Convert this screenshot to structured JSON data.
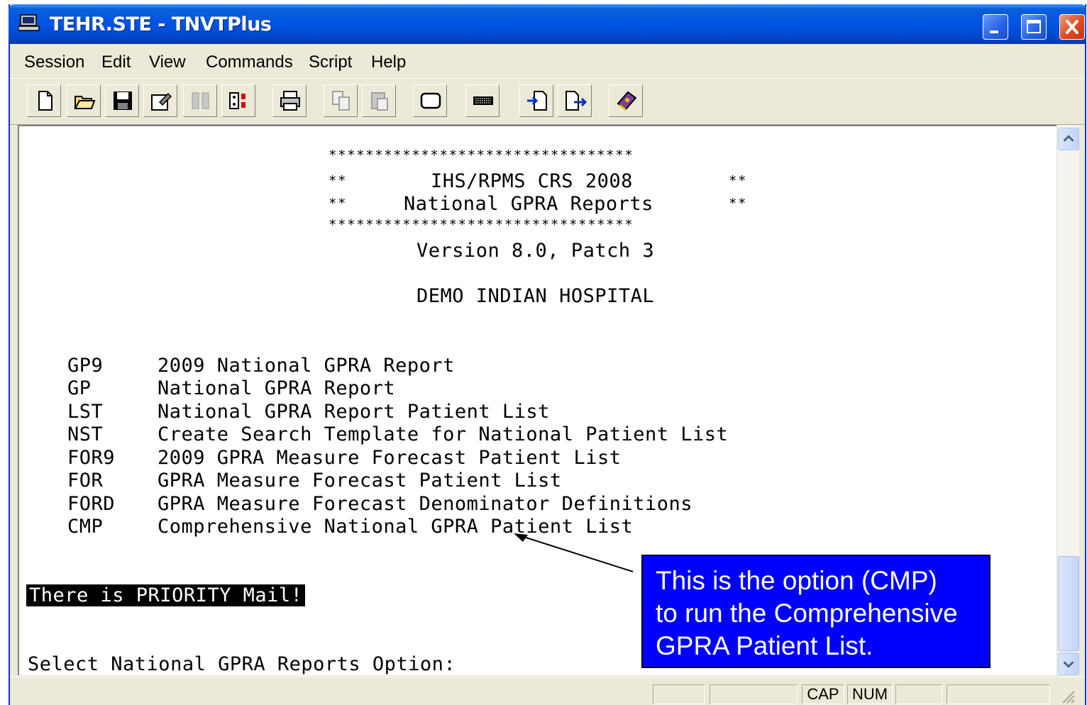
{
  "window": {
    "title": "TEHR.STE - TNVTPlus"
  },
  "menubar": {
    "items": [
      "Session",
      "Edit",
      "View",
      "Commands",
      "Script",
      "Help"
    ]
  },
  "toolbar": {
    "icons": [
      "new-icon",
      "open-icon",
      "save-icon",
      "properties-icon",
      "session-settings-icon",
      "keyboard-map-icon",
      "print-icon",
      "copy-icon",
      "paste-icon",
      "blank-screen-icon",
      "keypad-icon",
      "receive-file-icon",
      "send-file-icon",
      "help-book-icon"
    ]
  },
  "terminal": {
    "stars_line": "*********************************",
    "header_line1_prefix": "**",
    "header_title": "IHS/RPMS CRS 2008",
    "header_line2_prefix": "**",
    "header_subtitle": "National GPRA Reports",
    "header_suffix": "**",
    "version": "Version 8.0, Patch 3",
    "facility": "DEMO INDIAN HOSPITAL",
    "menu_options": [
      {
        "code": "GP9",
        "label": "2009 National GPRA Report"
      },
      {
        "code": "GP",
        "label": "National GPRA Report"
      },
      {
        "code": "LST",
        "label": "National GPRA Report Patient List"
      },
      {
        "code": "NST",
        "label": "Create Search Template for National Patient List"
      },
      {
        "code": "FOR9",
        "label": "2009 GPRA Measure Forecast Patient List"
      },
      {
        "code": "FOR",
        "label": "GPRA Measure Forecast Patient List"
      },
      {
        "code": "FORD",
        "label": "GPRA Measure Forecast Denominator Definitions"
      },
      {
        "code": "CMP",
        "label": "Comprehensive National GPRA Patient List"
      }
    ],
    "priority_notice": "There is PRIORITY Mail!",
    "prompt": "Select National GPRA Reports Option:"
  },
  "callout": {
    "text_lines": [
      "This is the option (CMP)",
      "to run the Comprehensive",
      "GPRA Patient List."
    ],
    "background": "#0000ff"
  },
  "statusbar": {
    "cap": "CAP",
    "num": "NUM"
  }
}
